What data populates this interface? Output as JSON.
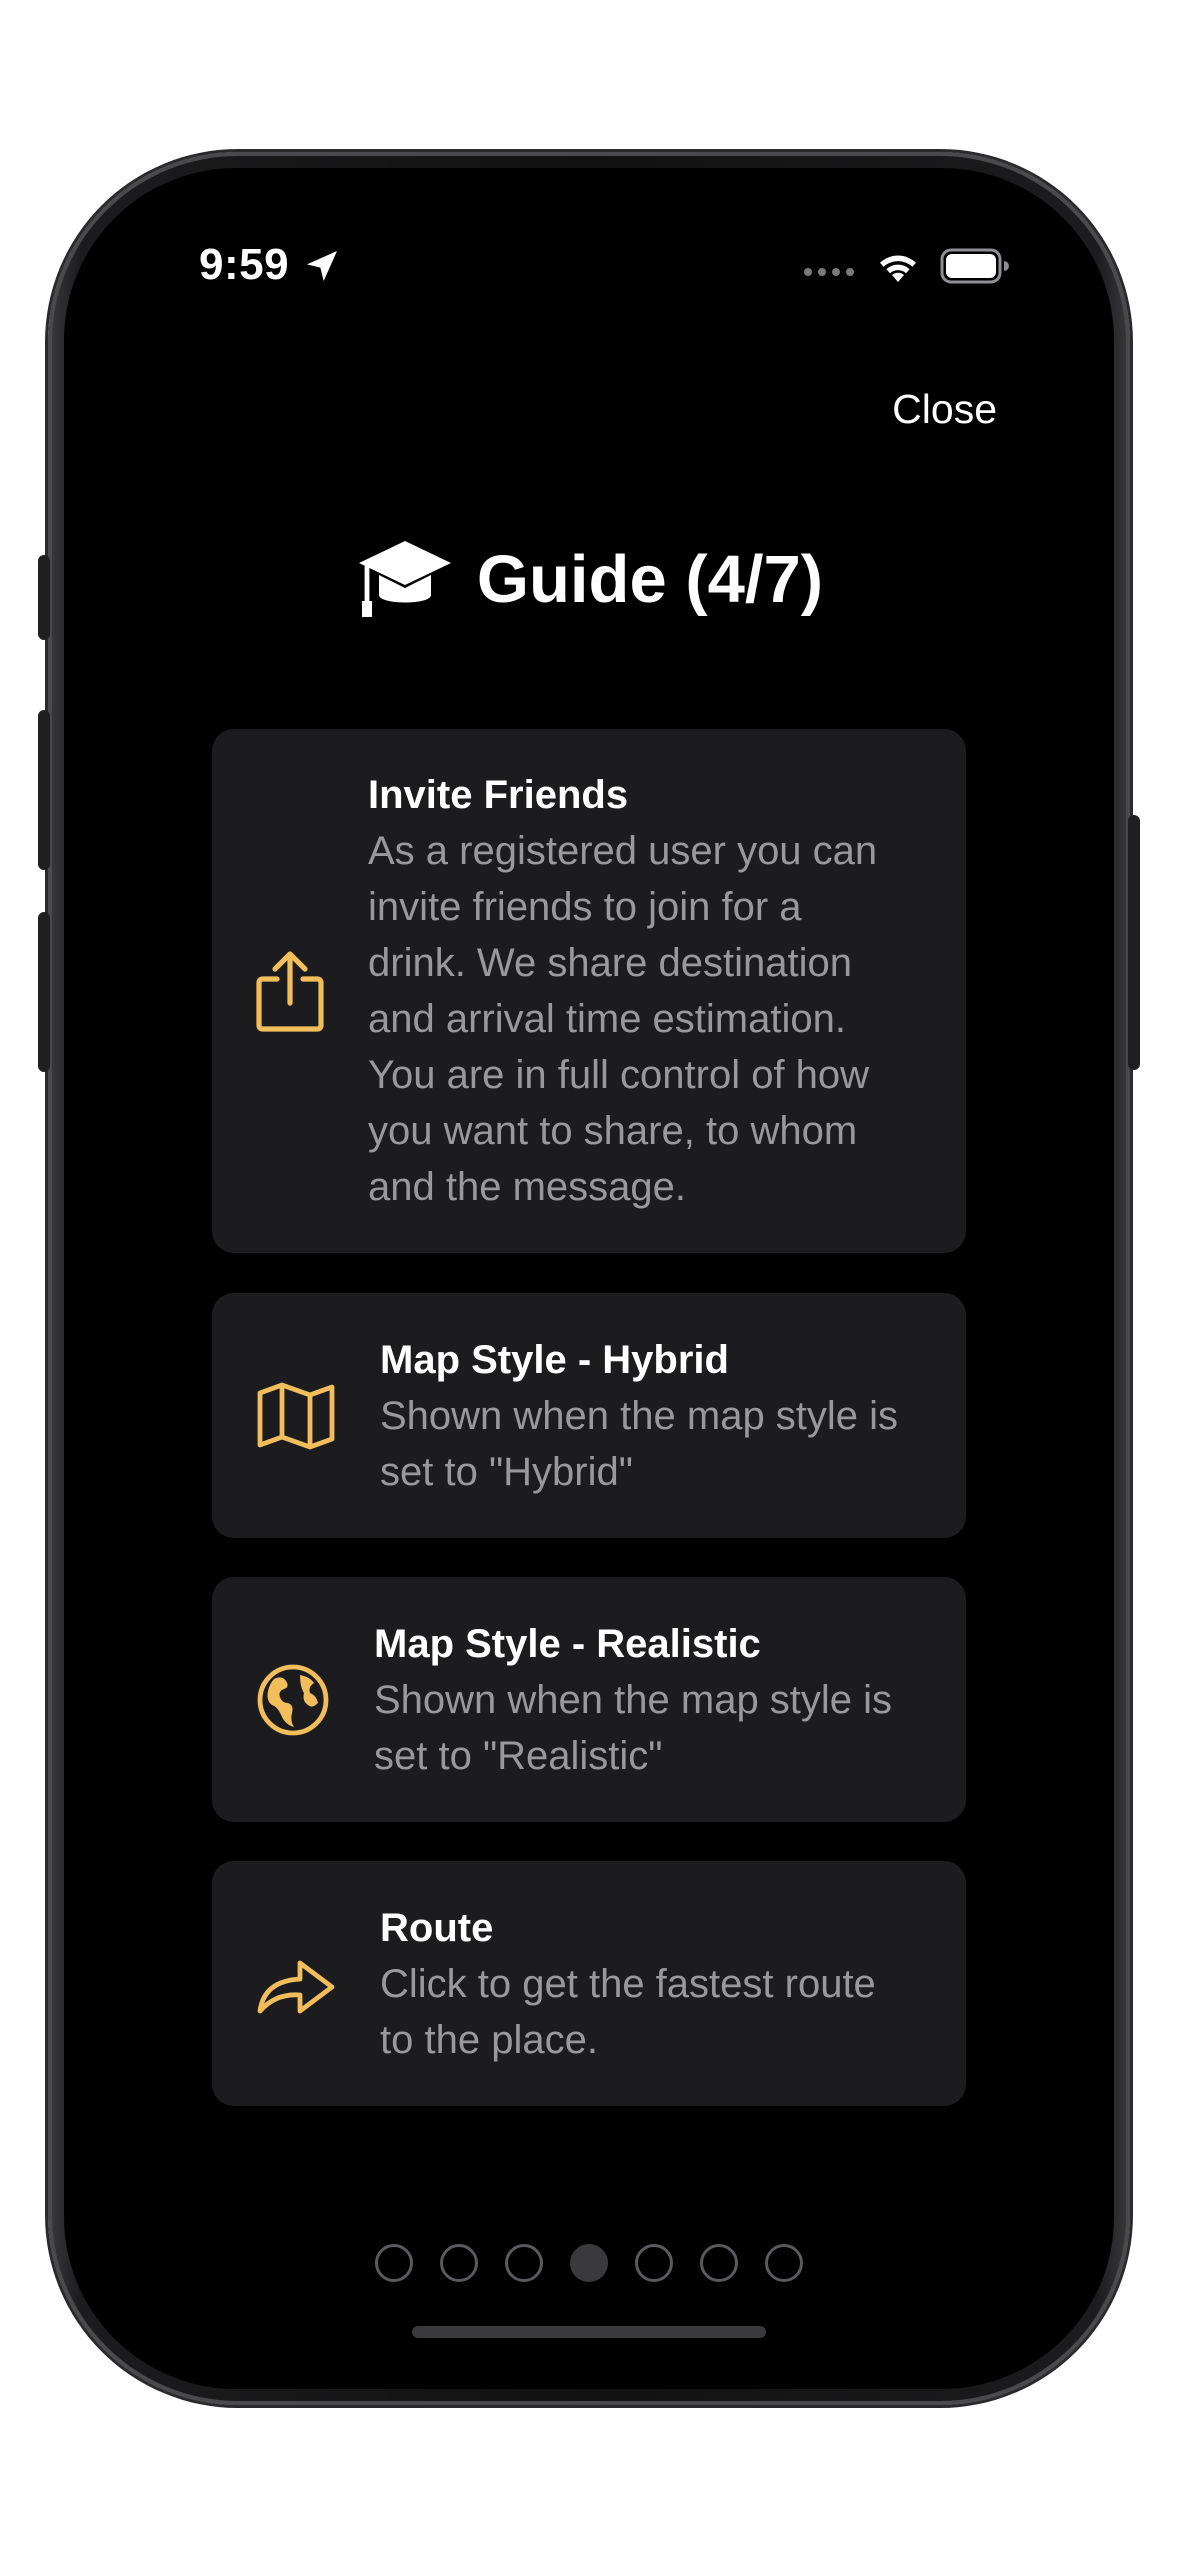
{
  "status_bar": {
    "time": "9:59",
    "location_icon": "location-arrow-icon",
    "signal_icon": "cellular-dots-icon",
    "wifi_icon": "wifi-icon",
    "battery_icon": "battery-icon"
  },
  "header": {
    "close_label": "Close",
    "title": "Guide (4/7)",
    "title_icon": "graduation-cap-icon"
  },
  "cards": [
    {
      "icon": "share-icon",
      "title": "Invite Friends",
      "description": "As a registered user you can invite friends to join for a drink. We share destination and arrival time estimation. You are in full control of how you want to share, to whom and the message."
    },
    {
      "icon": "map-icon",
      "title": "Map Style - Hybrid",
      "description": "Shown when the map style is set to \"Hybrid\""
    },
    {
      "icon": "globe-icon",
      "title": "Map Style - Realistic",
      "description": "Shown when the map style is set to \"Realistic\""
    },
    {
      "icon": "route-arrow-icon",
      "title": "Route",
      "description": "Click to get the fastest route to the place."
    }
  ],
  "pager": {
    "total_pages": 7,
    "current_page": 4
  },
  "colors": {
    "accent": "#F2BE5C",
    "background": "#000000",
    "card_background": "#1C1C1E",
    "secondary_text": "#98989D"
  }
}
